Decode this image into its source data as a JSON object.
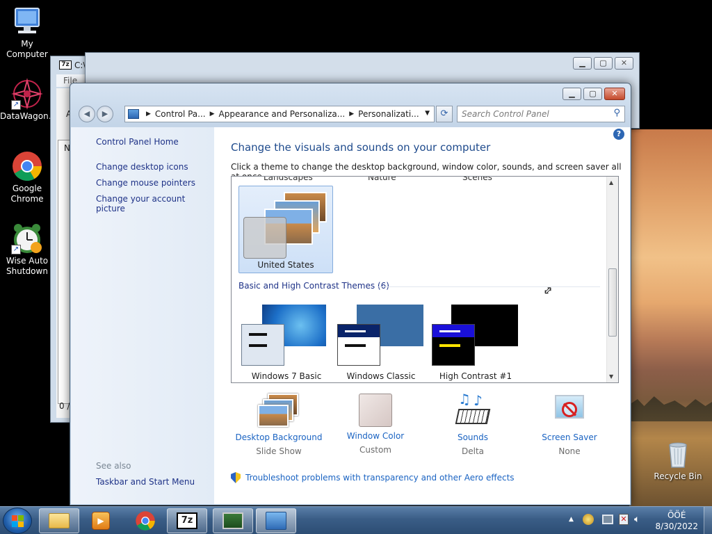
{
  "desktop": {
    "icons": [
      {
        "label": "My Computer"
      },
      {
        "label": "DataWagon..."
      },
      {
        "label": "Google Chrome"
      },
      {
        "label": "Wise Auto Shutdown"
      },
      {
        "label": "Recycle Bin"
      }
    ]
  },
  "bg_window_1": {
    "title_partial": "C:\\",
    "menu_file": "File",
    "row_a": "A",
    "col_n": "N",
    "status": "0 /"
  },
  "window": {
    "breadcrumb": [
      "Control Pa...",
      "Appearance and Personaliza...",
      "Personalizati..."
    ],
    "search_placeholder": "Search Control Panel",
    "left_nav": {
      "home": "Control Panel Home",
      "links": [
        "Change desktop icons",
        "Change mouse pointers",
        "Change your account picture"
      ],
      "see_also": "See also",
      "see_also_links": [
        "Taskbar and Start Menu"
      ]
    },
    "title": "Change the visuals and sounds on your computer",
    "subtitle": "Click a theme to change the desktop background, window color, sounds, and screen saver all at once.",
    "themes": {
      "cut_labels": [
        "Landscapes",
        "Nature",
        "Scenes"
      ],
      "selected": "United States",
      "section_title": "Basic and High Contrast Themes (6)",
      "basic": [
        "Windows 7 Basic",
        "Windows Classic",
        "High Contrast #1"
      ]
    },
    "bottom": [
      {
        "label": "Desktop Background",
        "value": "Slide Show"
      },
      {
        "label": "Window Color",
        "value": "Custom"
      },
      {
        "label": "Sounds",
        "value": "Delta"
      },
      {
        "label": "Screen Saver",
        "value": "None"
      }
    ],
    "troubleshoot": "Troubleshoot problems with transparency and other Aero effects"
  },
  "taskbar": {
    "clock_time": "ÕÖÉ",
    "clock_date": "8/30/2022"
  },
  "colors": {
    "link": "#1a63c2",
    "title": "#1e4a8c",
    "nav_link": "#1e3287"
  }
}
